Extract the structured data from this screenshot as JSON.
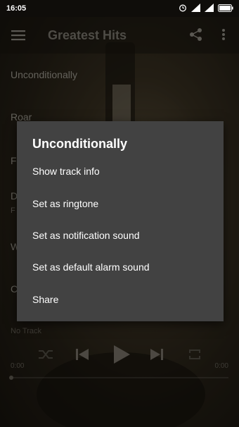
{
  "status_bar": {
    "time": "16:05",
    "icons": [
      "alarm-icon",
      "signal-icon",
      "signal-icon",
      "battery-icon"
    ]
  },
  "toolbar": {
    "title": "Greatest Hits",
    "menu_icon": "menu-icon",
    "share_icon": "share-icon",
    "more_icon": "more-vert-icon"
  },
  "tracks": [
    {
      "title": "Unconditionally",
      "subtitle": ""
    },
    {
      "title": "Roar",
      "subtitle": ""
    },
    {
      "title": "F",
      "subtitle": ""
    },
    {
      "title": "D",
      "subtitle": "F"
    },
    {
      "title": "W",
      "subtitle": ""
    },
    {
      "title": "C",
      "subtitle": ""
    }
  ],
  "player": {
    "now_playing": "No Track",
    "time_elapsed": "0:00",
    "time_total": "0:00",
    "progress": 0,
    "controls": [
      "shuffle-icon",
      "previous-icon",
      "play-icon",
      "next-icon",
      "repeat-icon"
    ]
  },
  "dialog": {
    "title": "Unconditionally",
    "items": [
      "Show track info",
      "Set as ringtone",
      "Set as notification sound",
      "Set as default alarm sound",
      "Share"
    ]
  },
  "colors": {
    "dialog_bg": "#424242",
    "statusbar_bg": "#0f0d0a",
    "background_tone": "#3f3625"
  }
}
